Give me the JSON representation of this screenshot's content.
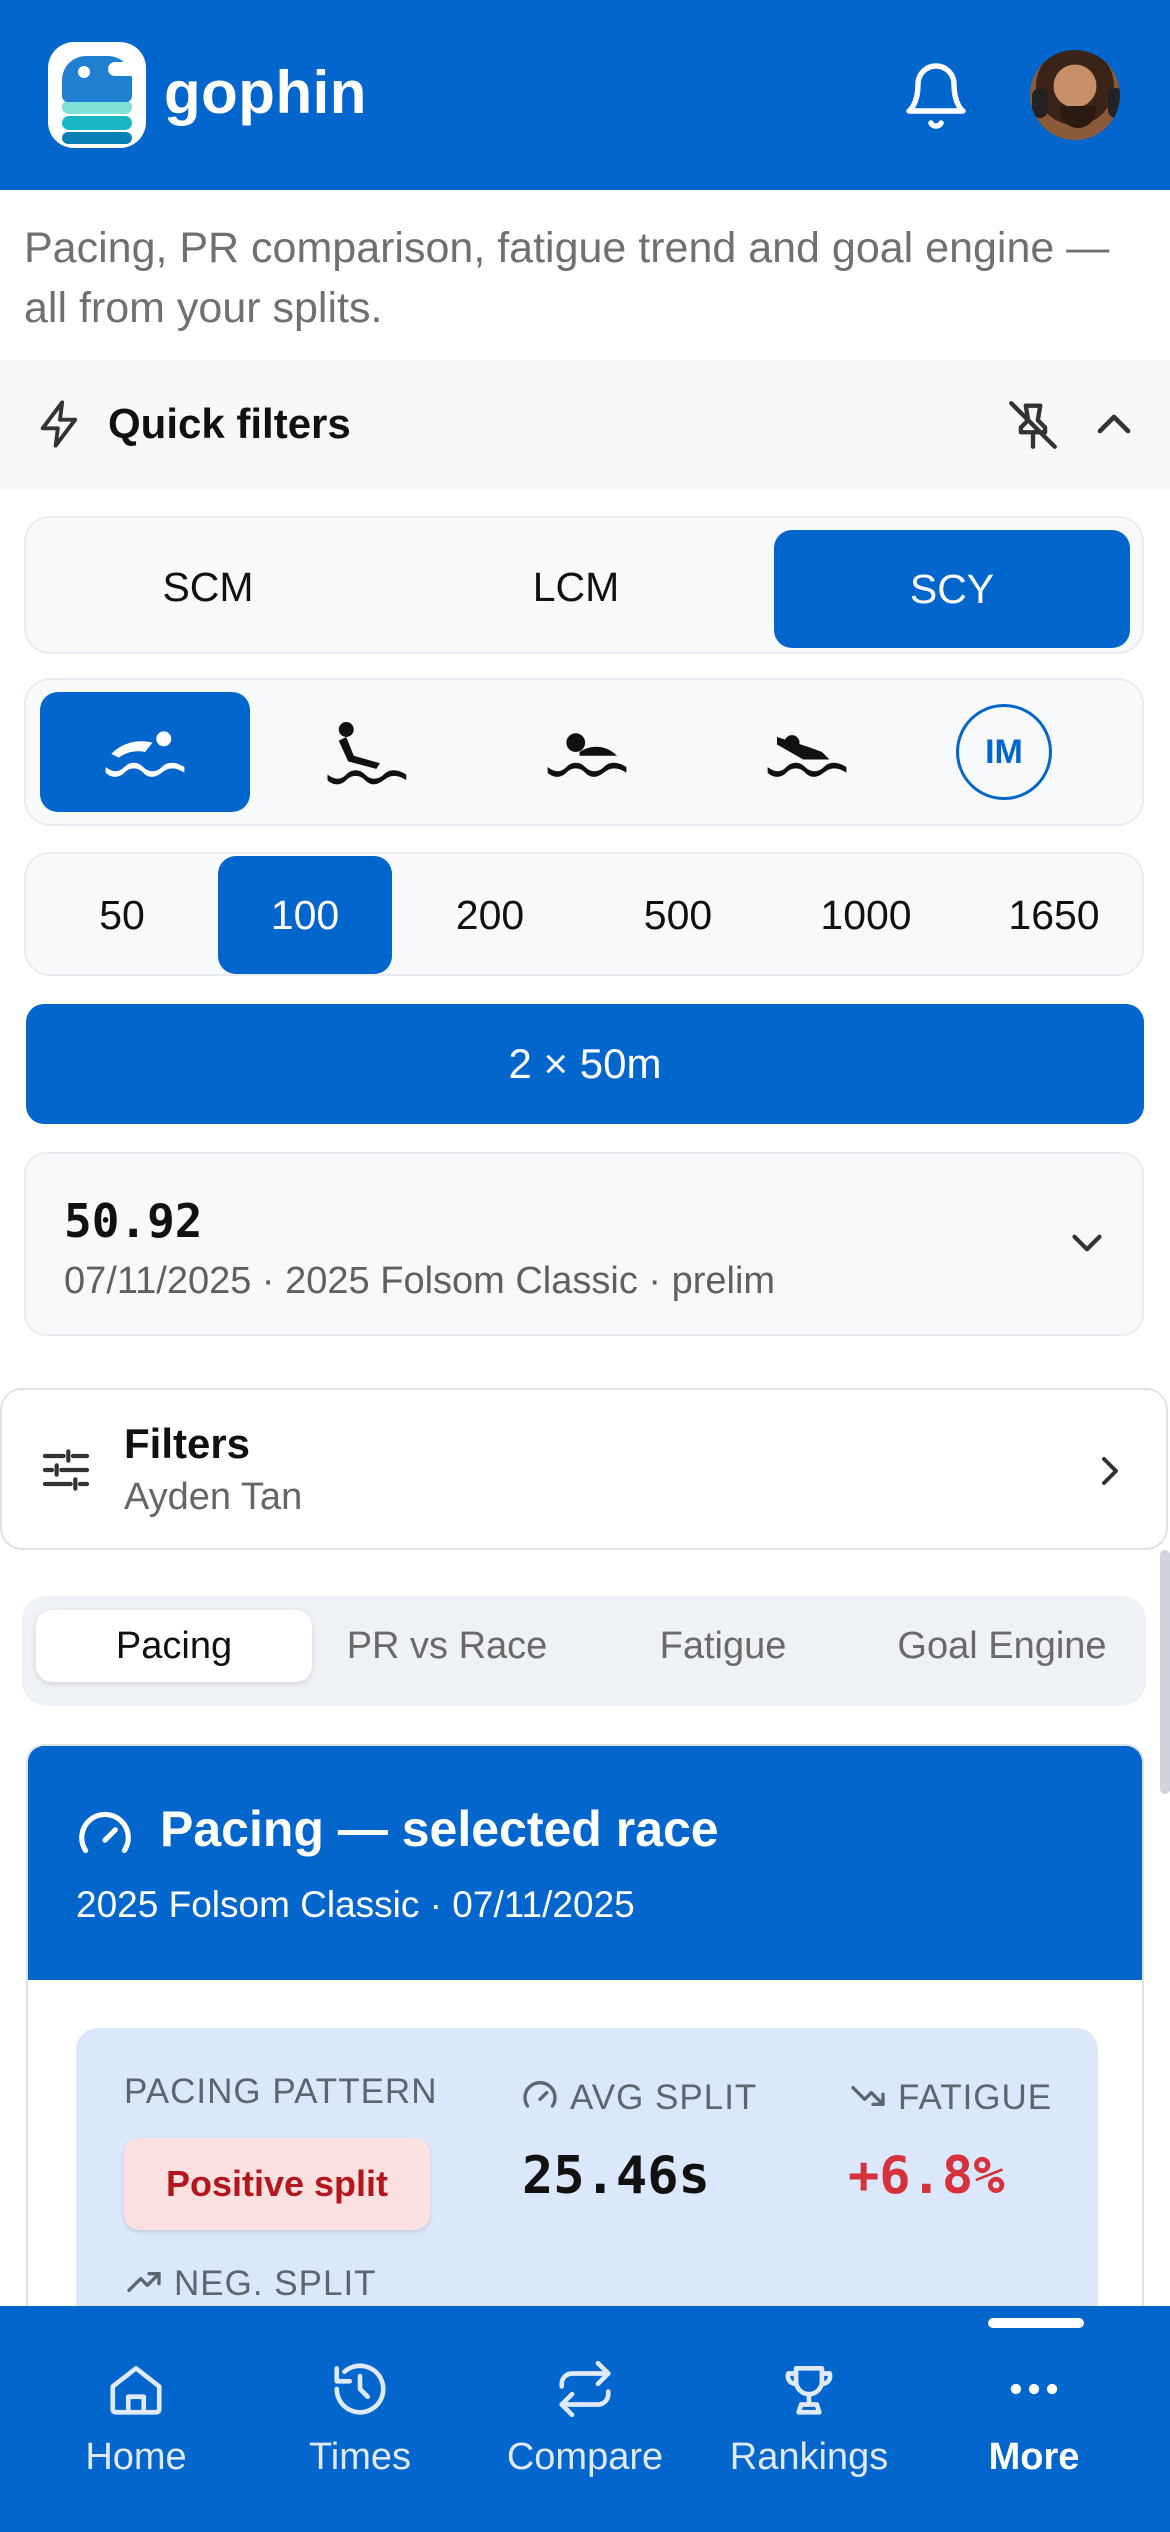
{
  "header": {
    "brand": "gophin",
    "logo_icon": "gopher-logo-icon",
    "bell_icon": "bell-icon",
    "avatar_icon": "avatar"
  },
  "subtitle": "Pacing, PR comparison, fatigue trend and goal engine — all from your splits.",
  "quick_filters": {
    "title": "Quick filters",
    "icons": [
      "bolt-icon",
      "unpin-icon",
      "chevron-up-icon"
    ],
    "course": {
      "options": [
        "SCM",
        "LCM",
        "SCY"
      ],
      "selected": "SCY"
    },
    "strokes": {
      "options": [
        {
          "name": "freestyle",
          "icon": "freestyle-swimmer-icon"
        },
        {
          "name": "backstroke",
          "icon": "backstroke-swimmer-icon"
        },
        {
          "name": "breaststroke",
          "icon": "breaststroke-swimmer-icon"
        },
        {
          "name": "butterfly",
          "icon": "butterfly-swimmer-icon"
        },
        {
          "name": "im",
          "label": "IM"
        }
      ],
      "selected": "freestyle"
    },
    "distances": {
      "options": [
        "50",
        "100",
        "200",
        "500",
        "1000",
        "1650"
      ],
      "selected": "100"
    },
    "relay_button": "2 × 50m"
  },
  "selected_time": {
    "time": "50.92",
    "meta": "07/11/2025 · 2025 Folsom Classic · prelim"
  },
  "filters": {
    "title": "Filters",
    "swimmer": "Ayden Tan"
  },
  "tabs": {
    "items": [
      "Pacing",
      "PR vs Race",
      "Fatigue",
      "Goal Engine"
    ],
    "active": "Pacing"
  },
  "pacing": {
    "title": "Pacing — selected race",
    "subtitle": "2025 Folsom Classic · 07/11/2025",
    "pattern_label": "PACING PATTERN",
    "pattern_value": "Positive split",
    "avg_split_label": "AVG SPLIT",
    "avg_split_value": "25.46s",
    "fatigue_label": "FATIGUE",
    "fatigue_value": "+6.8%",
    "neg_split_label": "NEG. SPLIT",
    "colors": {
      "primary": "#0366cc",
      "negative": "#d6323c",
      "badge_text": "#b3171d"
    }
  },
  "bottom_nav": {
    "items": [
      {
        "label": "Home",
        "icon": "home-icon"
      },
      {
        "label": "Times",
        "icon": "history-icon"
      },
      {
        "label": "Compare",
        "icon": "compare-icon"
      },
      {
        "label": "Rankings",
        "icon": "trophy-icon"
      },
      {
        "label": "More",
        "icon": "more-icon"
      }
    ],
    "active": "More"
  }
}
